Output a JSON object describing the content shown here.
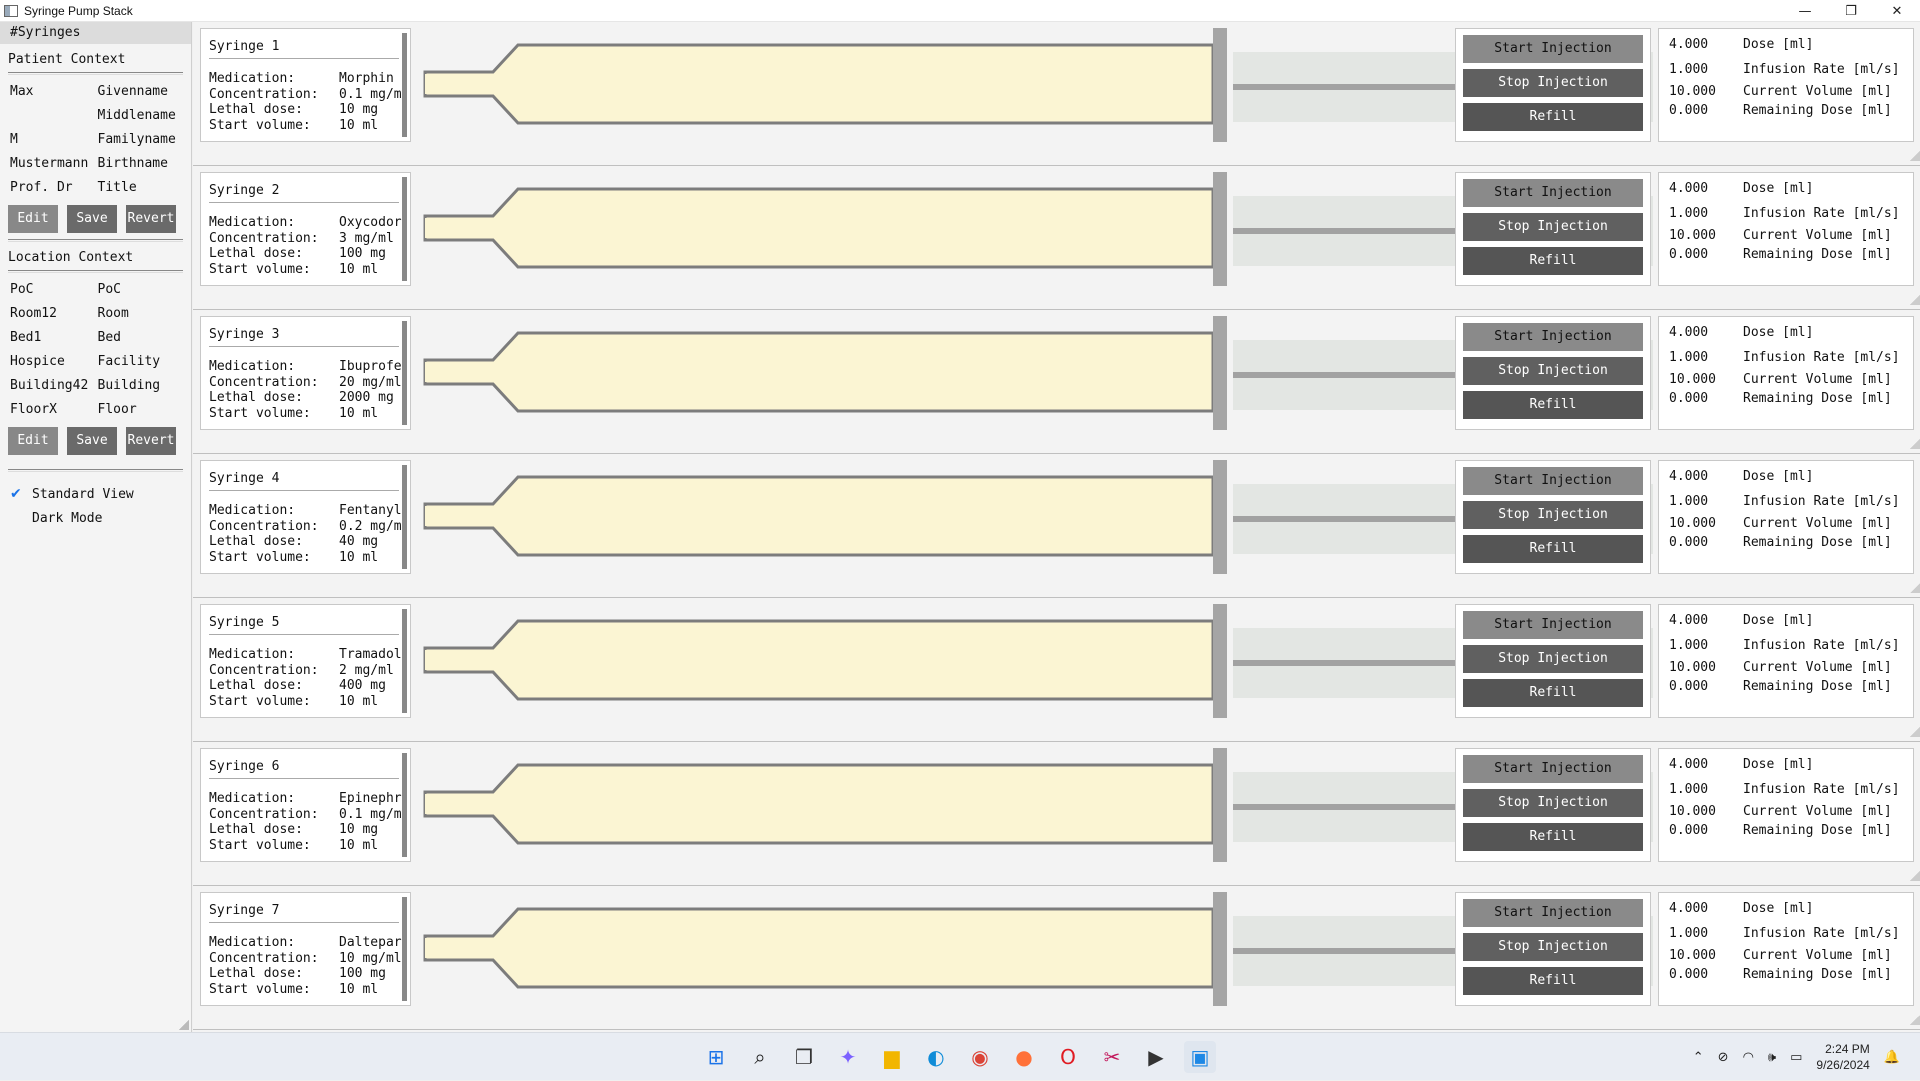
{
  "window": {
    "title": "Syringe Pump Stack",
    "minimize": "—",
    "maximize": "❐",
    "close": "✕"
  },
  "sidebar": {
    "header": "#Syringes",
    "patient_title": "Patient Context",
    "patient_rows": [
      {
        "value": "Max",
        "key": "Givenname"
      },
      {
        "value": "",
        "key": "Middlename"
      },
      {
        "value": "M",
        "key": "Familyname"
      },
      {
        "value": "Mustermann",
        "key": "Birthname"
      },
      {
        "value": "Prof. Dr",
        "key": "Title"
      }
    ],
    "location_title": "Location Context",
    "location_rows": [
      {
        "value": "PoC",
        "key": "PoC"
      },
      {
        "value": "Room12",
        "key": "Room"
      },
      {
        "value": "Bed1",
        "key": "Bed"
      },
      {
        "value": "Hospice",
        "key": "Facility"
      },
      {
        "value": "Building42",
        "key": "Building"
      },
      {
        "value": "FloorX",
        "key": "Floor"
      }
    ],
    "edit_label": "Edit",
    "save_label": "Save",
    "revert_label": "Revert",
    "standard_view_label": "Standard View",
    "standard_view_checked": "✔",
    "dark_mode_label": "Dark Mode"
  },
  "labels": {
    "medication": "Medication:",
    "concentration": "Concentration:",
    "lethal": "Lethal dose:",
    "start_volume": "Start volume:",
    "start_injection": "Start Injection",
    "stop_injection": "Stop Injection",
    "refill": "Refill",
    "dose": "Dose [ml]",
    "infusion_rate": "Infusion Rate [ml/s]",
    "current_volume": "Current Volume [ml]",
    "remaining_dose": "Remaining Dose [ml]"
  },
  "syringes": [
    {
      "name": "Syringe 1",
      "medication": "Morphin",
      "concentration": "0.1 mg/m",
      "lethal": "10 mg",
      "start_volume": "10 ml",
      "dose": "4.000",
      "rate": "1.000",
      "current": "10.000",
      "remaining": "0.000"
    },
    {
      "name": "Syringe 2",
      "medication": "Oxycodor",
      "concentration": "3 mg/ml",
      "lethal": "100 mg",
      "start_volume": "10 ml",
      "dose": "4.000",
      "rate": "1.000",
      "current": "10.000",
      "remaining": "0.000"
    },
    {
      "name": "Syringe 3",
      "medication": "Ibuprofe",
      "concentration": "20 mg/ml",
      "lethal": "2000 mg",
      "start_volume": "10 ml",
      "dose": "4.000",
      "rate": "1.000",
      "current": "10.000",
      "remaining": "0.000"
    },
    {
      "name": "Syringe 4",
      "medication": "Fentanyl",
      "concentration": "0.2 mg/m",
      "lethal": "40 mg",
      "start_volume": "10 ml",
      "dose": "4.000",
      "rate": "1.000",
      "current": "10.000",
      "remaining": "0.000"
    },
    {
      "name": "Syringe 5",
      "medication": "Tramadol",
      "concentration": "2 mg/ml",
      "lethal": "400 mg",
      "start_volume": "10 ml",
      "dose": "4.000",
      "rate": "1.000",
      "current": "10.000",
      "remaining": "0.000"
    },
    {
      "name": "Syringe 6",
      "medication": "Epinephr",
      "concentration": "0.1 mg/m",
      "lethal": "10 mg",
      "start_volume": "10 ml",
      "dose": "4.000",
      "rate": "1.000",
      "current": "10.000",
      "remaining": "0.000"
    },
    {
      "name": "Syringe 7",
      "medication": "Daltepar",
      "concentration": "10 mg/ml",
      "lethal": "100 mg",
      "start_volume": "10 ml",
      "dose": "4.000",
      "rate": "1.000",
      "current": "10.000",
      "remaining": "0.000"
    }
  ],
  "colors": {
    "fluid": "#fbf5d3",
    "outline": "#7c7c7c"
  },
  "taskbar": {
    "icons": [
      "windows-start-icon",
      "search-icon",
      "task-view-icon",
      "copilot-icon",
      "file-explorer-icon",
      "edge-icon",
      "chrome-icon",
      "firefox-icon",
      "opera-icon",
      "snipping-tool-icon",
      "terminal-icon",
      "syringe-app-icon"
    ],
    "time": "2:24 PM",
    "date": "9/26/2024"
  }
}
